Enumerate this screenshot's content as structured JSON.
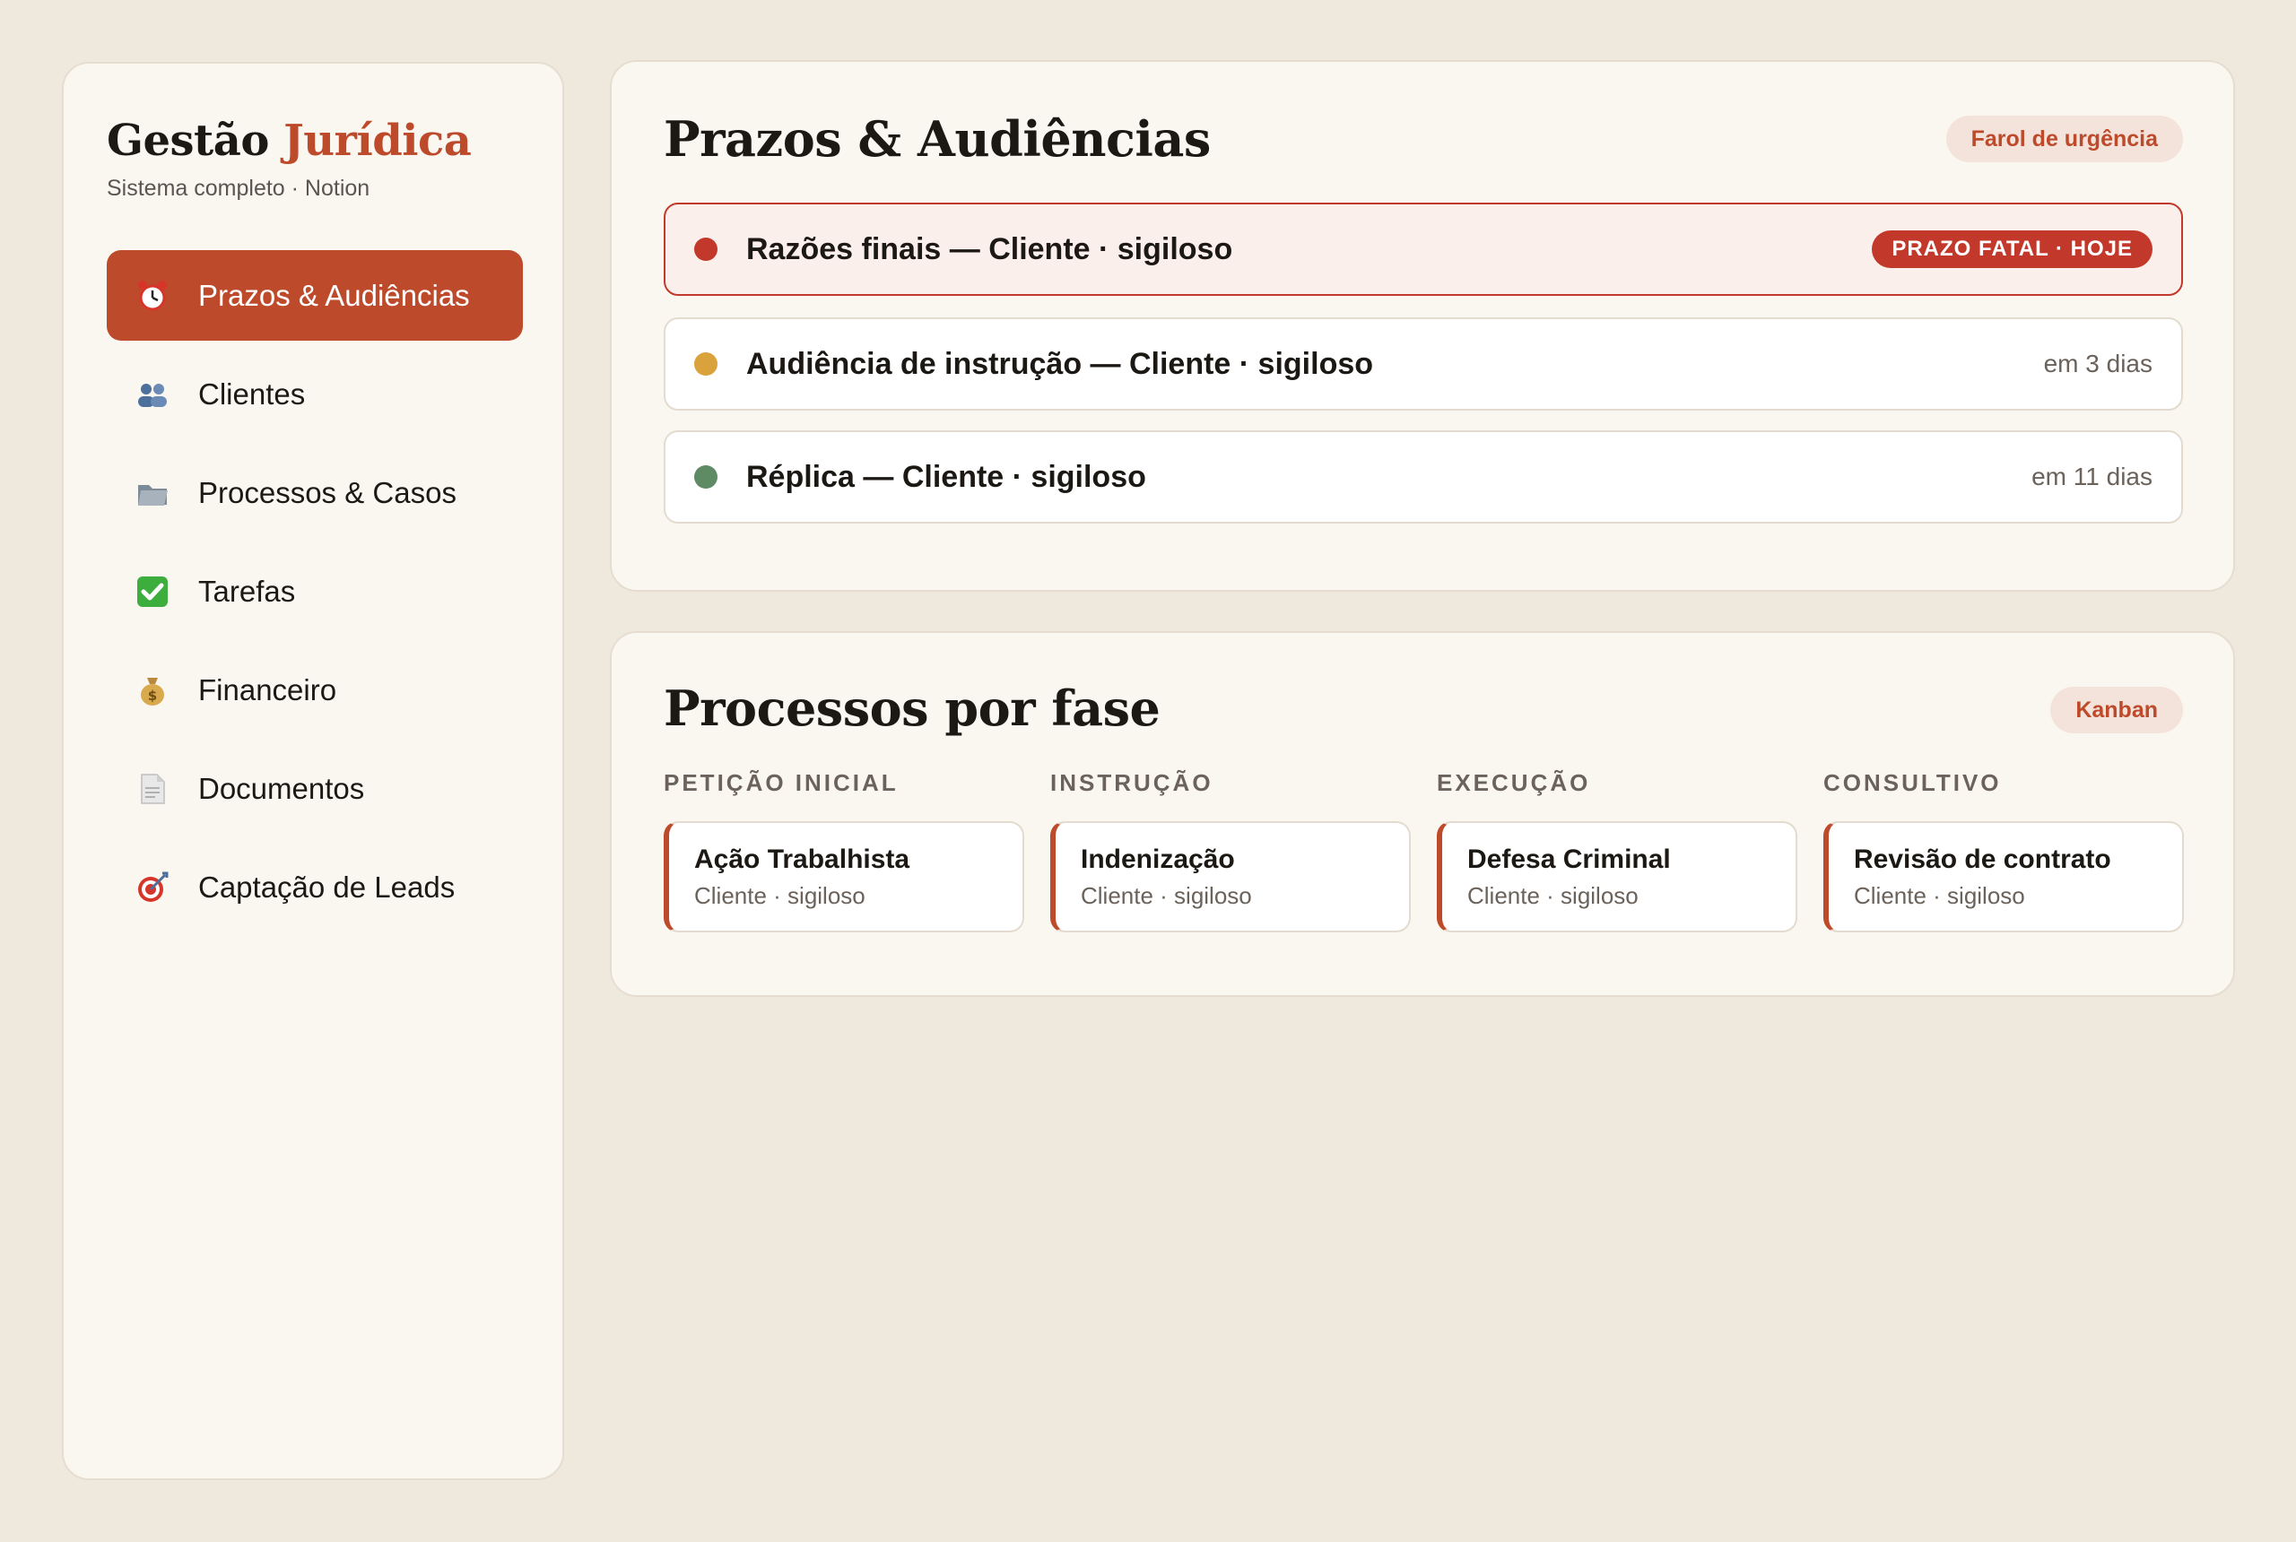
{
  "sidebar": {
    "brand_prefix": "Gestão",
    "brand_accent": "Jurídica",
    "subtitle": "Sistema completo · Notion",
    "items": [
      {
        "label": "Prazos & Audiências",
        "icon": "alarm-clock-icon",
        "active": true
      },
      {
        "label": "Clientes",
        "icon": "people-icon",
        "active": false
      },
      {
        "label": "Processos & Casos",
        "icon": "folder-icon",
        "active": false
      },
      {
        "label": "Tarefas",
        "icon": "check-mark-icon",
        "active": false
      },
      {
        "label": "Financeiro",
        "icon": "money-bag-icon",
        "active": false
      },
      {
        "label": "Documentos",
        "icon": "document-icon",
        "active": false
      },
      {
        "label": "Captação de Leads",
        "icon": "target-icon",
        "active": false
      }
    ]
  },
  "deadlines": {
    "title": "Prazos & Audiências",
    "pill": "Farol de urgência",
    "items": [
      {
        "text": "Razões finais — Cliente · sigiloso",
        "status": "PRAZO FATAL · HOJE",
        "dot_color": "#c2392b",
        "urgent": true
      },
      {
        "text": "Audiência de instrução — Cliente · sigiloso",
        "status": "em 3 dias",
        "dot_color": "#d9a23b",
        "urgent": false
      },
      {
        "text": "Réplica — Cliente · sigiloso",
        "status": "em 11 dias",
        "dot_color": "#5e8a64",
        "urgent": false
      }
    ]
  },
  "kanban": {
    "title": "Processos por fase",
    "pill": "Kanban",
    "columns": [
      {
        "header": "PETIÇÃO INICIAL",
        "card": {
          "title": "Ação Trabalhista",
          "client": "Cliente · sigiloso"
        }
      },
      {
        "header": "INSTRUÇÃO",
        "card": {
          "title": "Indenização",
          "client": "Cliente · sigiloso"
        }
      },
      {
        "header": "EXECUÇÃO",
        "card": {
          "title": "Defesa Criminal",
          "client": "Cliente · sigiloso"
        }
      },
      {
        "header": "CONSULTIVO",
        "card": {
          "title": "Revisão de contrato",
          "client": "Cliente · sigiloso"
        }
      }
    ]
  },
  "colors": {
    "accent": "#bd4a2b",
    "urgent": "#c2392b",
    "background": "#efe8dd",
    "panel": "#faf7f1"
  }
}
